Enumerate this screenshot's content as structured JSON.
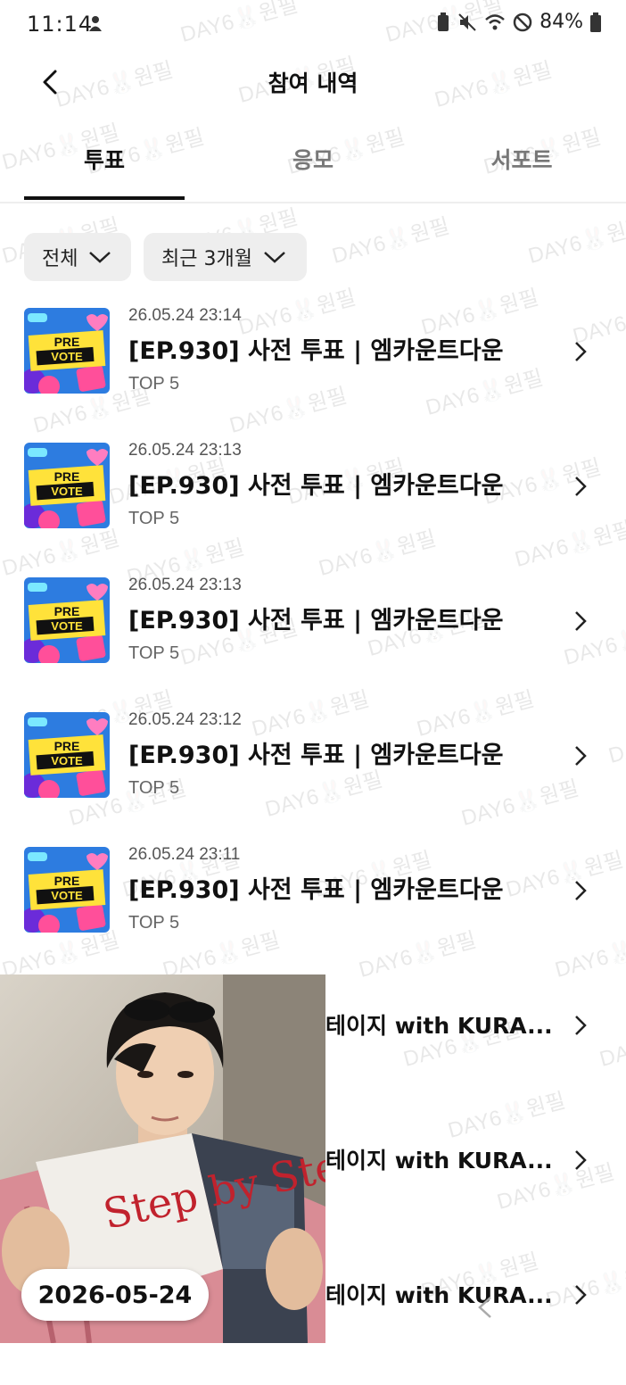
{
  "status_bar": {
    "time": "11:14",
    "battery": "84%"
  },
  "header": {
    "title": "참여 내역"
  },
  "tabs": [
    {
      "label": "투표",
      "active": true
    },
    {
      "label": "응모",
      "active": false
    },
    {
      "label": "서포트",
      "active": false
    }
  ],
  "filters": {
    "type": "전체",
    "period": "최근 3개월"
  },
  "items": [
    {
      "date": "26.05.24 23:14",
      "title": "[EP.930] 사전 투표 | 엠카운트다운",
      "sub": "TOP 5"
    },
    {
      "date": "26.05.24 23:13",
      "title": "[EP.930] 사전 투표 | 엠카운트다운",
      "sub": "TOP 5"
    },
    {
      "date": "26.05.24 23:13",
      "title": "[EP.930] 사전 투표 | 엠카운트다운",
      "sub": "TOP 5"
    },
    {
      "date": "26.05.24 23:12",
      "title": "[EP.930] 사전 투표 | 엠카운트다운",
      "sub": "TOP 5"
    },
    {
      "date": "26.05.24 23:11",
      "title": "[EP.930] 사전 투표 | 엠카운트다운",
      "sub": "TOP 5"
    }
  ],
  "partial_items": [
    {
      "title": "테이지 with KURA..."
    },
    {
      "title": "테이지 with KURA..."
    },
    {
      "title": "테이지 with KURA..."
    }
  ],
  "thumb": {
    "line1": "PRE",
    "line2": "VOTE"
  },
  "photo_overlay": {
    "date": "2026-05-24",
    "book_text": "Step by Step"
  },
  "watermark": "DAY6🐰원필",
  "colors": {
    "thumb_bg": "#2d7ce0",
    "thumb_yellow": "#ffe23a",
    "thumb_pink": "#ff4f9a"
  }
}
